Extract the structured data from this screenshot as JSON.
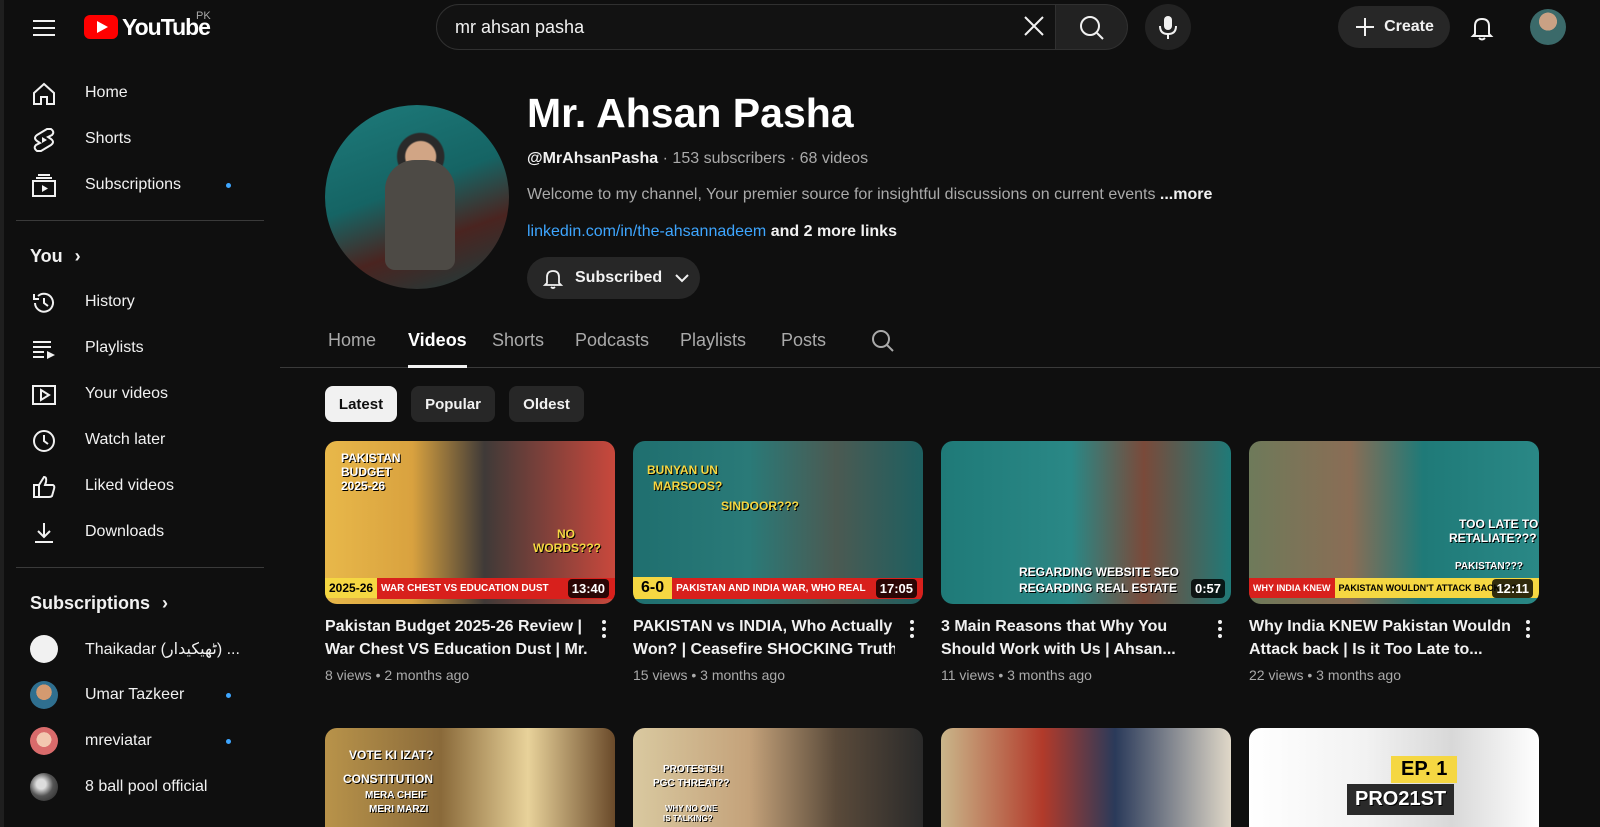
{
  "topbar": {
    "logo_text": "YouTube",
    "region": "PK",
    "search_value": "mr ahsan pasha",
    "create_label": "Create"
  },
  "sidebar": {
    "main": [
      {
        "label": "Home",
        "icon": "home-icon"
      },
      {
        "label": "Shorts",
        "icon": "shorts-icon"
      },
      {
        "label": "Subscriptions",
        "icon": "subscriptions-icon",
        "dot": true
      }
    ],
    "you_heading": "You",
    "you_items": [
      {
        "label": "History",
        "icon": "history-icon"
      },
      {
        "label": "Playlists",
        "icon": "playlists-icon"
      },
      {
        "label": "Your videos",
        "icon": "your-videos-icon"
      },
      {
        "label": "Watch later",
        "icon": "watch-later-icon"
      },
      {
        "label": "Liked videos",
        "icon": "liked-icon"
      },
      {
        "label": "Downloads",
        "icon": "download-icon"
      }
    ],
    "subs_heading": "Subscriptions",
    "subs": [
      {
        "label": "Thaikadar (ٹھیکیدار) ...",
        "dot": false
      },
      {
        "label": "Umar Tazkeer",
        "dot": true
      },
      {
        "label": "mreviatar",
        "dot": true
      },
      {
        "label": "8 ball pool official",
        "dot": false
      }
    ]
  },
  "channel": {
    "name": "Mr. Ahsan Pasha",
    "handle": "@MrAhsanPasha",
    "stats": " · 153 subscribers · 68 videos",
    "description": "Welcome to my channel, Your premier source for insightful discussions on current events ",
    "more": "...more",
    "link": "linkedin.com/in/the-ahsannadeem",
    "more_links": " and 2 more links",
    "subscribed_label": "Subscribed"
  },
  "tabs": [
    "Home",
    "Videos",
    "Shorts",
    "Podcasts",
    "Playlists",
    "Posts"
  ],
  "active_tab": "Videos",
  "chips": [
    "Latest",
    "Popular",
    "Oldest"
  ],
  "active_chip": "Latest",
  "videos": [
    {
      "title_l1": "Pakistan Budget 2025-26 Review |",
      "title_l2": "War Chest VS Education Dust | Mr....",
      "meta": "8 views • 2 months ago",
      "duration": "13:40",
      "thumb_texts": [
        "PAKISTAN",
        "BUDGET",
        "2025-26",
        "NO",
        "WORDS???",
        "2025-26",
        "WAR CHEST VS EDUCATION DUST"
      ]
    },
    {
      "title_l1": "PAKISTAN vs INDIA, Who Actually",
      "title_l2": "Won? | Ceasefire SHOCKING Truth",
      "meta": "15 views • 3 months ago",
      "duration": "17:05",
      "thumb_texts": [
        "BUNYAN UN",
        "MARSOOS?",
        "SINDOOR???",
        "6-0",
        "PAKISTAN AND INDIA WAR, WHO REAL"
      ]
    },
    {
      "title_l1": "3 Main Reasons that Why You",
      "title_l2": "Should Work with Us | Ahsan...",
      "meta": "11 views • 3 months ago",
      "duration": "0:57",
      "thumb_texts": [
        "REGARDING WEBSITE SEO",
        "REGARDING REAL ESTATE"
      ]
    },
    {
      "title_l1": "Why India KNEW Pakistan Wouldn't",
      "title_l2": "Attack back | Is it Too Late to...",
      "meta": "22 views • 3 months ago",
      "duration": "12:11",
      "thumb_texts": [
        "TOO LATE TO",
        "RETALIATE???",
        "PAKISTAN???",
        "WHY INDIA KNEW",
        "PAKISTAN WOULDN'T ATTACK BACK???"
      ]
    }
  ],
  "row2_thumb_texts": [
    "VOTE KI IZAT?",
    "CONSTITUTION",
    "MERA CHEIF",
    "MERI MARZI",
    "PROTESTS!!",
    "PGC THREAT??",
    "WHY NO ONE",
    "IS TALKING?",
    "EP. 1",
    "PRO21ST"
  ],
  "colors": {
    "accent": "#3ea6ff",
    "brand_red": "#ff0000",
    "background": "#0f0f0f"
  }
}
